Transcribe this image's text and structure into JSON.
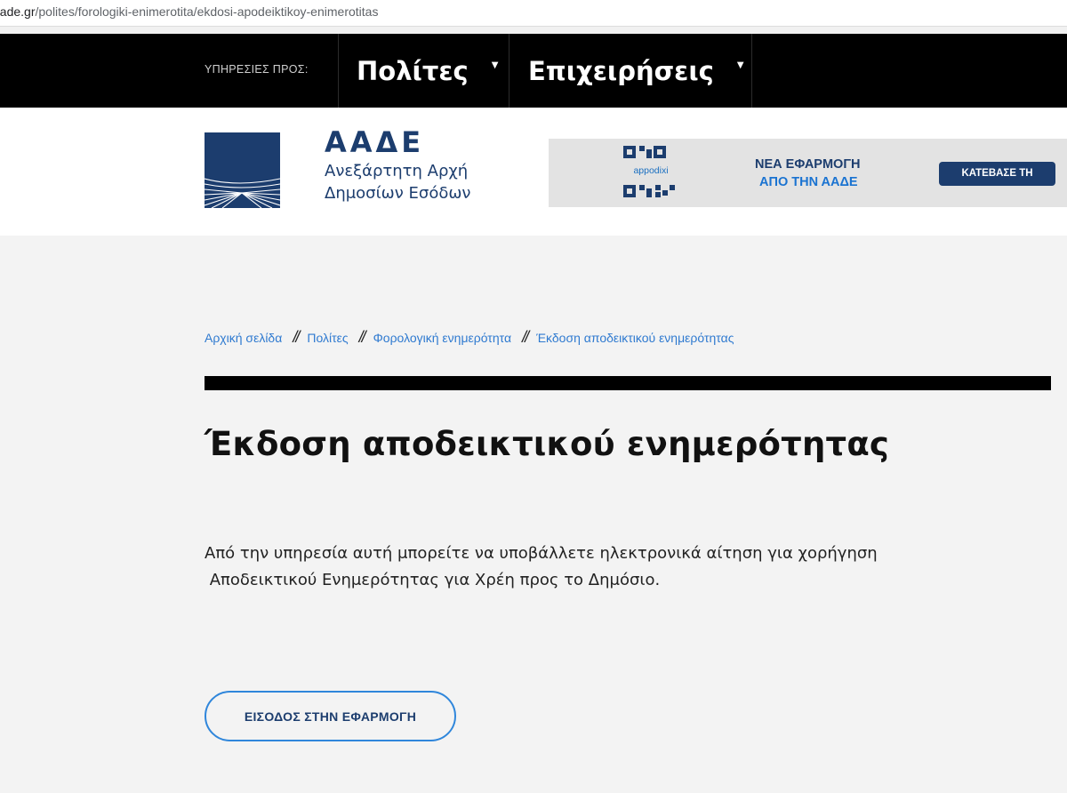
{
  "browser": {
    "url_host": "aade.gr",
    "url_path": "/polites/forologiki-enimerotita/ekdosi-apodeiktikoy-enimerotitas"
  },
  "topnav": {
    "prefix": "ΥΠΗΡΕΣΙΕΣ ΠΡΟΣ:",
    "items": [
      {
        "label": "Πολίτες",
        "icon": "caret-down-icon"
      },
      {
        "label": "Επιχειρήσεις",
        "icon": "caret-down-icon"
      }
    ],
    "caret_glyph": "▼"
  },
  "header": {
    "brand_abbr": "ΑΑΔΕ",
    "brand_line1": "Ανεξάρτητη Αρχή",
    "brand_line2": "Δημοσίων Εσόδων",
    "brand_color": "#1c3d6e"
  },
  "banner": {
    "app_label": "appodixi",
    "title_line1": "ΝΕΑ ΕΦΑΡΜΟΓΗ",
    "title_line2": "ΑΠΟ ΤΗΝ ΑΑΔΕ",
    "download_label": "ΚΑΤΕΒΑΣΕ ΤΗ"
  },
  "breadcrumb": {
    "items": [
      "Αρχική σελίδα",
      "Πολίτες",
      "Φορολογική ενημερότητα",
      "Έκδοση αποδεικτικού ενημερότητας"
    ],
    "separator": "//"
  },
  "main": {
    "title": "Έκδοση αποδεικτικού ενημερότητας",
    "desc_line1": "Από την υπηρεσία αυτή μπορείτε να υποβάλλετε ηλεκτρονικά αίτηση για χορήγηση",
    "desc_line2": " Αποδεικτικού Ενημερότητας για Χρέη προς το Δημόσιο.",
    "cta_label": "ΕΙΣΟΔΟΣ ΣΤΗΝ ΕΦΑΡΜΟΓΗ"
  },
  "colors": {
    "accent_blue": "#2f86db",
    "link_blue": "#2f7ad0",
    "nav_bg": "#000000",
    "page_bg": "#f3f3f3"
  }
}
